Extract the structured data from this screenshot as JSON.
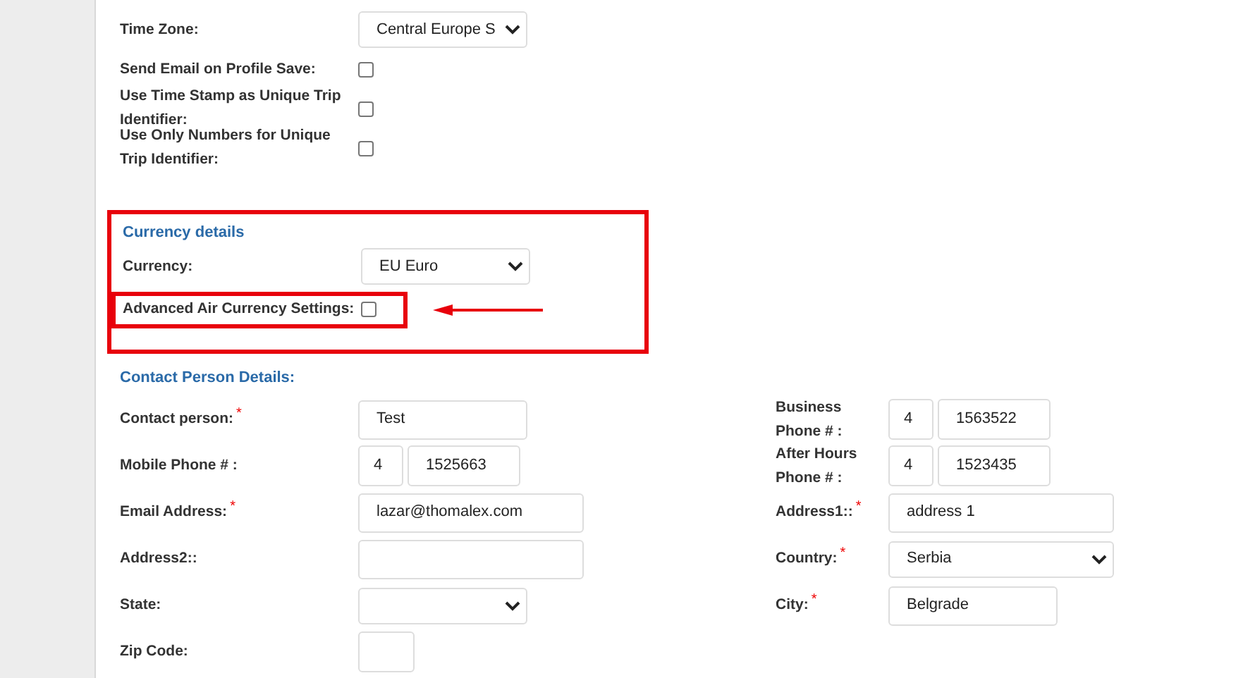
{
  "top_fields": [
    {
      "kind": "select",
      "label": "Time Zone:",
      "value": "Central Europe S"
    },
    {
      "kind": "checkbox",
      "label": "Send Email on Profile Save:",
      "checked": false
    },
    {
      "kind": "checkbox",
      "label": "Use Time Stamp as Unique Trip Identifier:",
      "checked": false
    },
    {
      "kind": "checkbox",
      "label": "Use Only Numbers for Unique Trip Identifier:",
      "checked": false
    }
  ],
  "currency_section": {
    "title": "Currency details",
    "highlighted": true,
    "fields": [
      {
        "kind": "select",
        "label": "Currency:",
        "value": "EU Euro"
      },
      {
        "kind": "checkbox",
        "label": "Advanced Air Currency Settings:",
        "checked": false,
        "highlighted": true
      }
    ]
  },
  "contact_section": {
    "title": "Contact Person Details:",
    "left": [
      {
        "kind": "text",
        "label": "Contact person:",
        "mark": "*",
        "value": "Test"
      },
      {
        "kind": "phone",
        "label": "Mobile Phone # :",
        "code": "4",
        "value": "1525663"
      },
      {
        "kind": "text",
        "label": "Email Address:",
        "mark": "*",
        "value": "lazar@thomalex.com",
        "wide": true
      },
      {
        "kind": "text",
        "label": "Address2::",
        "wide": true
      },
      {
        "kind": "select",
        "label": "State:",
        "wide": false
      },
      {
        "kind": "zip",
        "label": "Zip Code:"
      }
    ],
    "right": [
      {
        "kind": "phone",
        "label": "Business Phone # :",
        "code": "4",
        "value": "1563522"
      },
      {
        "kind": "phone",
        "label": "After Hours Phone # :",
        "code": "4",
        "value": "1523435"
      },
      {
        "kind": "text",
        "label": "Address1::",
        "mark": "*",
        "value": "address 1",
        "wide": true
      },
      {
        "kind": "select",
        "label": "Country:",
        "mark": "*",
        "value": "Serbia",
        "wide": true
      },
      {
        "kind": "text",
        "label": "City:",
        "mark": "*",
        "value": "Belgrade",
        "wide": false
      }
    ]
  }
}
